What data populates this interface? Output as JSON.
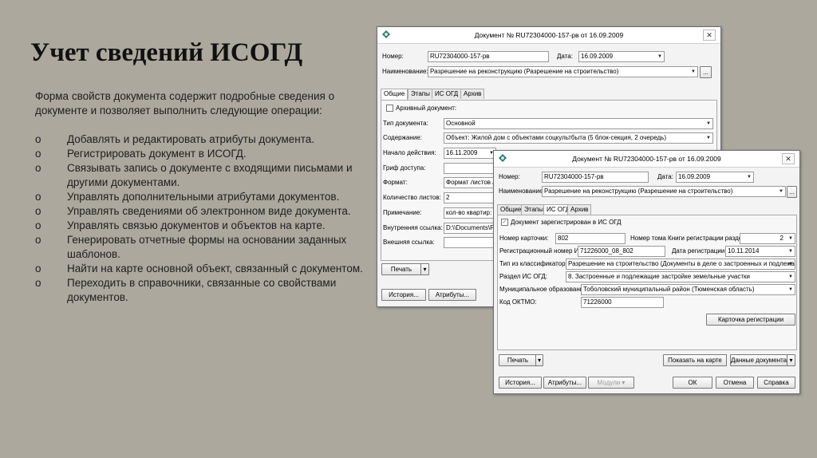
{
  "slide": {
    "title": "Учет сведений ИСОГД",
    "intro": "Форма свойств документа содержит подробные сведения о документе и позволяет выполнить следующие операции:",
    "bullet_marker": "o",
    "bullets": [
      "Добавлять и редактировать атрибуты документа.",
      "Регистрировать документ в ИСОГД.",
      "Связывать запись о документе с входящими письмами и другими документами.",
      "Управлять дополнительными атрибутами документов.",
      "Управлять сведениями об электронном виде документа.",
      "Управлять связью документов и объектов на карте.",
      "Генерировать отчетные формы на основании заданных шаблонов.",
      "Найти на карте основной объект, связанный с документом.",
      "Переходить в справочники, связанные со свойствами документов."
    ]
  },
  "back_window": {
    "title": "Документ № RU72304000-157-рв от 16.09.2009",
    "close": "✕",
    "number_label": "Номер:",
    "number_value": "RU72304000-157-рв",
    "date_label": "Дата:",
    "date_value": "16.09.2009",
    "name_label": "Наименование:",
    "name_value": "Разрешение на реконструкцию (Разрешение на строительство)",
    "ellipsis": "...",
    "tabs": [
      "Общие",
      "Этапы",
      "ИС ОГД",
      "Архив"
    ],
    "archive_label": "Архивный документ:",
    "labels": [
      "Тип документа:",
      "Содержание:",
      "Начало действия:",
      "Гриф доступа:",
      "Формат:",
      "Количество листов:",
      "Примечание:",
      "Внутренняя ссылка:",
      "Внешняя ссылка:"
    ],
    "values": [
      "Основной",
      "Объект: Жилой дом с объектами соцкультбыта (5 блок-секция, 2 очередь)",
      "16.11.2009",
      "",
      "Формат листов А",
      "2",
      "кол-во квартир:",
      "D:\\\\Documents\\Ра",
      ""
    ],
    "print": "Печать",
    "history": "История...",
    "attributes": "Атрибуты..."
  },
  "front_window": {
    "title": "Документ № RU72304000-157-рв от 16.09.2009",
    "close": "✕",
    "number_label": "Номер:",
    "number_value": "RU72304000-157-рв",
    "date_label": "Дата:",
    "date_value": "16.09.2009",
    "name_label": "Наименование:",
    "name_value": "Разрешение на реконструкцию (Разрешение на строительство)",
    "ellipsis": "...",
    "tabs": [
      "Общие",
      "Этапы",
      "ИС ОГД",
      "Архив"
    ],
    "registered_label": "Документ зарегистрирован в ИС ОГД",
    "card_no_label": "Номер карточки:",
    "card_no_value": "802",
    "volume_label": "Номер тома Книги регистрации раздела:",
    "volume_value": "2",
    "reg_no_label": "Регистрационный номер ИС ОГД:",
    "reg_no_value": "71226000_08_802",
    "reg_date_label": "Дата регистрации:",
    "reg_date_value": "10.11.2014",
    "classifier_label": "Тип из классификатора:",
    "classifier_value": "Разрешение на строительство (Документы в деле о застроенных и подлежащих за",
    "section_label": "Раздел ИС ОГД:",
    "section_value": "8. Застроенные и подлежащие застройке земельные участки",
    "municipal_label": "Муниципальное образование:",
    "municipal_value": "Тоболовский муниципальный район (Тюменская область)",
    "oktmo_label": "Код ОКТМО:",
    "oktmo_value": "71226000",
    "reg_card_btn": "Карточка регистрации",
    "print": "Печать",
    "show_map": "Показать на карте",
    "doc_data": "Данные документа",
    "history": "История...",
    "attributes": "Атрибуты...",
    "modules": "Модули",
    "ok": "ОК",
    "cancel": "Отмена",
    "help": "Справка"
  }
}
